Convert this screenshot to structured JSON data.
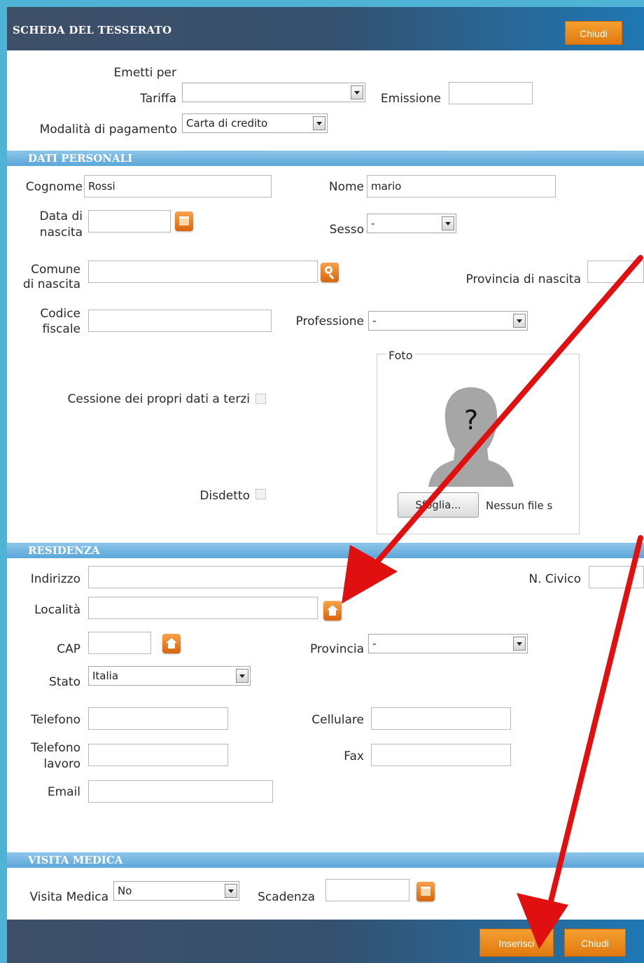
{
  "header": {
    "title": "SCHEDA DEL TESSERATO",
    "close_label": "Chiudi"
  },
  "emissione_block": {
    "emetti_per_label": "Emetti per",
    "tariffa_label": "Tariffa",
    "tariffa_value": "",
    "emissione_label": "Emissione",
    "emissione_value": "",
    "modalita_label": "Modalità di pagamento",
    "modalita_value": "Carta di credito"
  },
  "dati_personali": {
    "section_title": "DATI PERSONALI",
    "cognome_label": "Cognome",
    "cognome_value": "Rossi",
    "nome_label": "Nome",
    "nome_value": "mario",
    "data_label_1": "Data di",
    "data_label_2": "nascita",
    "sesso_label": "Sesso",
    "sesso_value": "-",
    "comune_label_1": "Comune",
    "comune_label_2": "di nascita",
    "provincia_nascita_label": "Provincia di nascita",
    "codice_label_1": "Codice",
    "codice_label_2": "fiscale",
    "professione_label": "Professione",
    "professione_value": "-",
    "cessione_label": "Cessione dei propri dati a terzi",
    "disdetto_label": "Disdetto",
    "foto_legend": "Foto",
    "foto_question": "?",
    "sfoglia_label": "Sfoglia...",
    "no_file_label": "Nessun file s"
  },
  "residenza": {
    "section_title": "RESIDENZA",
    "indirizzo_label": "Indirizzo",
    "civico_label": "N. Civico",
    "localita_label": "Località",
    "cap_label": "CAP",
    "provincia_label": "Provincia",
    "provincia_value": "-",
    "stato_label": "Stato",
    "stato_value": "Italia",
    "telefono_label": "Telefono",
    "cellulare_label": "Cellulare",
    "tel_lavoro_label_1": "Telefono",
    "tel_lavoro_label_2": "lavoro",
    "fax_label": "Fax",
    "email_label": "Email"
  },
  "visita_medica": {
    "section_title": "VISITA MEDICA",
    "visita_label": "Visita Medica",
    "visita_value": "No",
    "scadenza_label": "Scadenza"
  },
  "footer": {
    "inserisci_label": "Inserisci",
    "chiudi_label": "Chiudi"
  },
  "colors": {
    "accent_orange": "#e88a1f",
    "header_dark": "#3f4f68",
    "section_blue": "#6cb0de",
    "arrow_red": "#e01010"
  }
}
